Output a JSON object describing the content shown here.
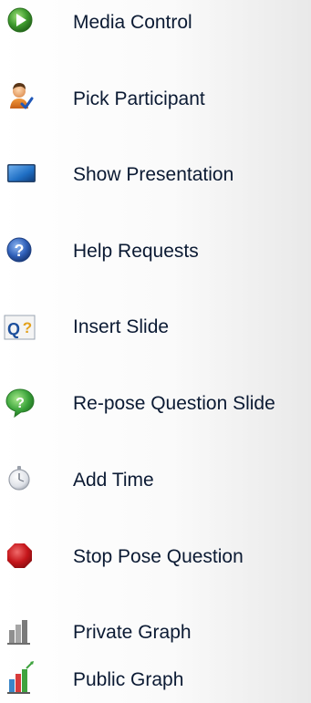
{
  "menu": {
    "items": [
      {
        "label": "Media Control",
        "icon": "play-icon",
        "accent": "#3f9b2f"
      },
      {
        "label": "Pick Participant",
        "icon": "participant-icon",
        "accent": "#e58a2c"
      },
      {
        "label": "Show Presentation",
        "icon": "presentation-icon",
        "accent": "#1f6fc4"
      },
      {
        "label": "Help Requests",
        "icon": "help-icon",
        "accent": "#2f5fb8"
      },
      {
        "label": "Insert Slide",
        "icon": "insert-slide-icon",
        "accent": "#1d4f9c"
      },
      {
        "label": "Re-pose Question Slide",
        "icon": "repose-question-icon",
        "accent": "#3aa33a"
      },
      {
        "label": "Add Time",
        "icon": "stopwatch-icon",
        "accent": "#b9bdc6"
      },
      {
        "label": "Stop Pose Question",
        "icon": "stop-icon",
        "accent": "#c5161b"
      },
      {
        "label": "Private Graph",
        "icon": "private-graph-icon",
        "accent": "#8f8f8f"
      },
      {
        "label": "Public Graph",
        "icon": "public-graph-icon",
        "accent": "#3b86c8"
      }
    ]
  }
}
